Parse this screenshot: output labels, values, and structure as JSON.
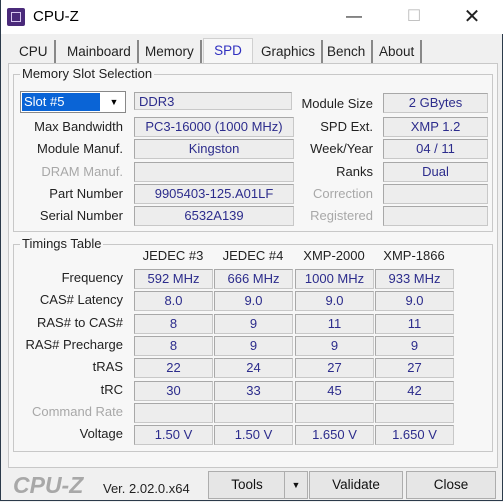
{
  "window": {
    "title": "CPU-Z",
    "minimize": "—",
    "maximize": "☐",
    "close": "✕"
  },
  "tabs": [
    {
      "label": "CPU"
    },
    {
      "label": "Mainboard"
    },
    {
      "label": "Memory"
    },
    {
      "label": "SPD"
    },
    {
      "label": "Graphics"
    },
    {
      "label": "Bench"
    },
    {
      "label": "About"
    }
  ],
  "slot": {
    "group_title": "Memory Slot Selection",
    "selected": "Slot #5",
    "type": "DDR3",
    "labels": {
      "max_bandwidth": "Max Bandwidth",
      "module_manuf": "Module Manuf.",
      "dram_manuf": "DRAM Manuf.",
      "part_number": "Part Number",
      "serial_number": "Serial Number",
      "module_size": "Module Size",
      "spd_ext": "SPD Ext.",
      "week_year": "Week/Year",
      "ranks": "Ranks",
      "correction": "Correction",
      "registered": "Registered"
    },
    "values": {
      "max_bandwidth": "PC3-16000 (1000 MHz)",
      "module_manuf": "Kingston",
      "dram_manuf": "",
      "part_number": "9905403-125.A01LF",
      "serial_number": "6532A139",
      "module_size": "2 GBytes",
      "spd_ext": "XMP 1.2",
      "week_year": "04 / 11",
      "ranks": "Dual",
      "correction": "",
      "registered": ""
    }
  },
  "timings": {
    "group_title": "Timings Table",
    "columns": [
      "JEDEC #3",
      "JEDEC #4",
      "XMP-2000",
      "XMP-1866"
    ],
    "rows": [
      {
        "label": "Frequency",
        "values": [
          "592 MHz",
          "666 MHz",
          "1000 MHz",
          "933 MHz"
        ]
      },
      {
        "label": "CAS# Latency",
        "values": [
          "8.0",
          "9.0",
          "9.0",
          "9.0"
        ]
      },
      {
        "label": "RAS# to CAS#",
        "values": [
          "8",
          "9",
          "11",
          "11"
        ]
      },
      {
        "label": "RAS# Precharge",
        "values": [
          "8",
          "9",
          "9",
          "9"
        ]
      },
      {
        "label": "tRAS",
        "values": [
          "22",
          "24",
          "27",
          "27"
        ]
      },
      {
        "label": "tRC",
        "values": [
          "30",
          "33",
          "45",
          "42"
        ]
      },
      {
        "label": "Command Rate",
        "values": [
          "",
          "",
          "",
          ""
        ]
      },
      {
        "label": "Voltage",
        "values": [
          "1.50 V",
          "1.50 V",
          "1.650 V",
          "1.650 V"
        ]
      }
    ]
  },
  "footer": {
    "logo": "CPU-Z",
    "version": "Ver. 2.02.0.x64",
    "tools": "Tools",
    "validate": "Validate",
    "close": "Close"
  }
}
